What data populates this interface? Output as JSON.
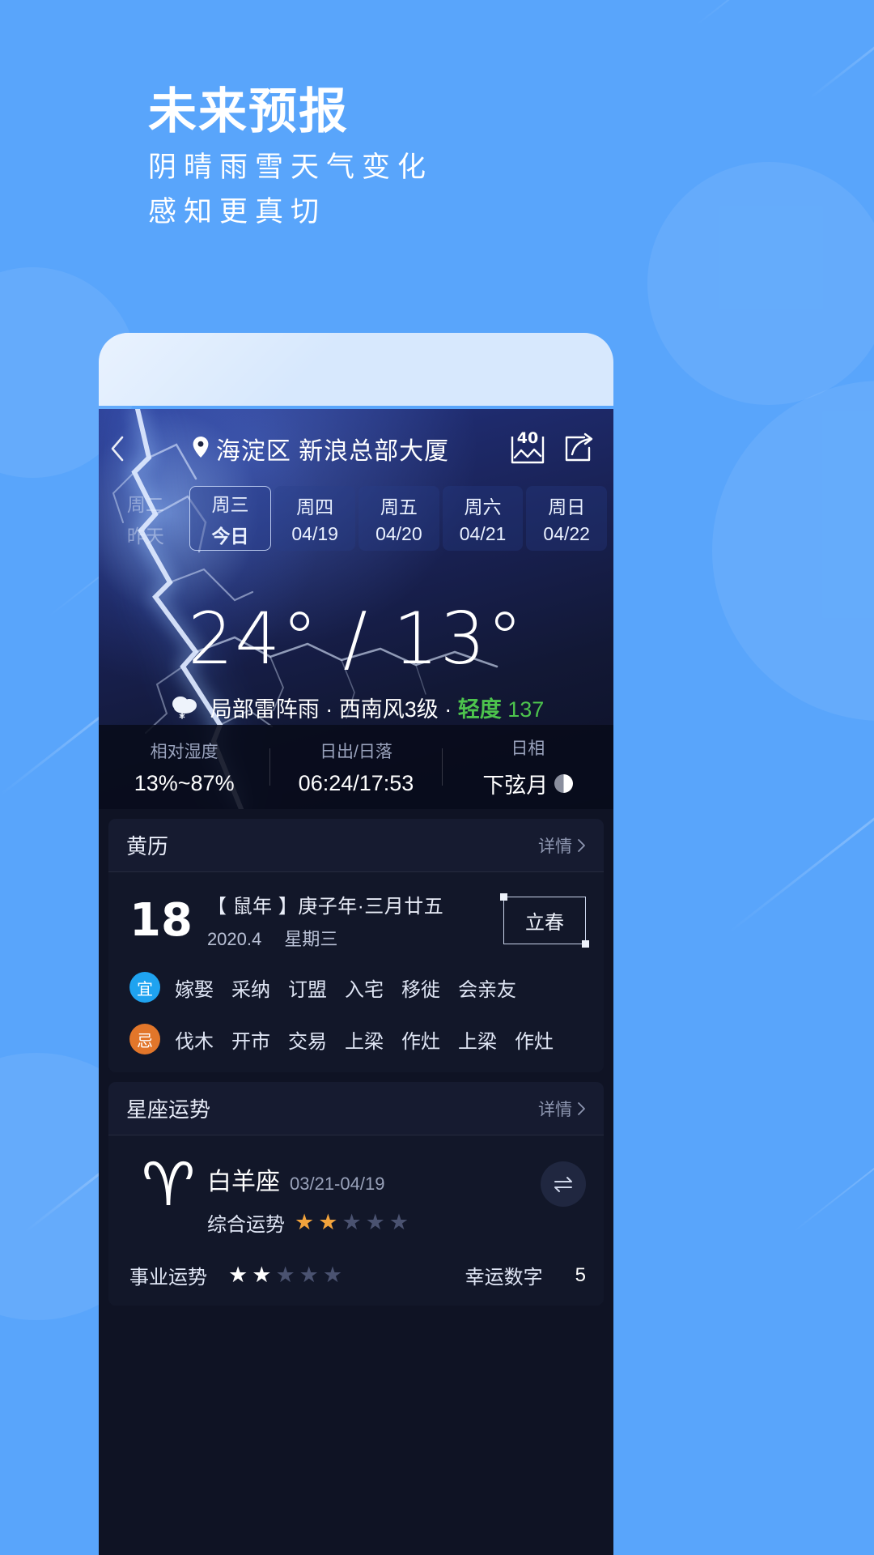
{
  "page": {
    "background_color": "#59a5fb",
    "title": "未来预报",
    "subtitle_line1": "阴晴雨雪天气变化",
    "subtitle_line2": "感知更真切"
  },
  "app": {
    "header": {
      "back_icon": "chevron-left-icon",
      "location_pin_icon": "location-pin-icon",
      "location": "海淀区 新浪总部大厦",
      "aqi_icon_label": "40",
      "aqi_icon": "aqi-chart-icon",
      "share_icon": "share-icon"
    },
    "days": [
      {
        "weekday": "周二",
        "date": "昨天",
        "state": "past"
      },
      {
        "weekday": "周三",
        "date": "今日",
        "state": "active"
      },
      {
        "weekday": "周四",
        "date": "04/19",
        "state": "normal"
      },
      {
        "weekday": "周五",
        "date": "04/20",
        "state": "normal"
      },
      {
        "weekday": "周六",
        "date": "04/21",
        "state": "normal"
      },
      {
        "weekday": "周日",
        "date": "04/22",
        "state": "normal"
      }
    ],
    "current": {
      "temperature": "24° / 13°",
      "weather_icon": "cloud-snow-icon",
      "condition": "局部雷阵雨 · 西南风3级 · ",
      "aqi_level": "轻度",
      "aqi_value": "137",
      "aqi_color": "#4dc44d"
    },
    "stats": [
      {
        "label": "相对湿度",
        "value": "13%~87%"
      },
      {
        "label": "日出/日落",
        "value": "06:24/17:53"
      },
      {
        "label": "日相",
        "value": "下弦月",
        "icon": "moon-phase-icon"
      }
    ],
    "almanac": {
      "card_title": "黄历",
      "more_label": "详情",
      "more_icon": "chevron-right-icon",
      "day_number": "18",
      "lunar_line": "【 鼠年 】庚子年·三月廿五",
      "year_month": "2020.4",
      "weekday": "星期三",
      "solar_term": "立春",
      "yi": {
        "badge": "宜",
        "badge_color": "#1fa3f0",
        "items": [
          "嫁娶",
          "采纳",
          "订盟",
          "入宅",
          "移徙",
          "会亲友"
        ]
      },
      "ji": {
        "badge": "忌",
        "badge_color": "#e2762a",
        "items": [
          "伐木",
          "开市",
          "交易",
          "上梁",
          "作灶",
          "上梁",
          "作灶"
        ]
      }
    },
    "horoscope": {
      "card_title": "星座运势",
      "more_label": "详情",
      "more_icon": "chevron-right-icon",
      "zodiac_glyph": "♈",
      "zodiac_name": "白羊座",
      "zodiac_range": "03/21-04/19",
      "overall_label": "综合运势",
      "overall_stars": 2,
      "overall_star_total": 5,
      "overall_star_color": "#f2a33c",
      "swap_icon": "swap-icon",
      "career_label": "事业运势",
      "career_stars": 2,
      "career_star_total": 5,
      "lucky_number_label": "幸运数字",
      "lucky_number": "5"
    }
  }
}
